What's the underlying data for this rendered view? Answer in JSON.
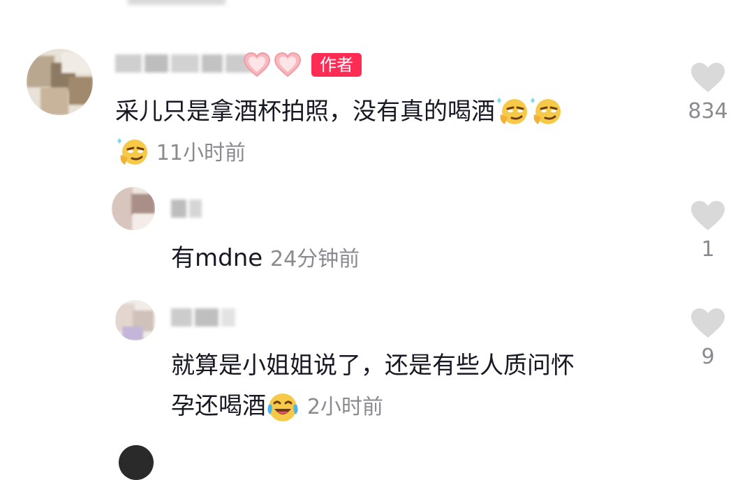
{
  "author_badge": "作者",
  "comments": [
    {
      "text": "采儿只是拿酒杯拍照，没有真的喝酒",
      "time": "11小时前",
      "likes": "834",
      "emoji": "smirk-emoji"
    },
    {
      "text": "有mdne",
      "time": "24分钟前",
      "likes": "1"
    },
    {
      "text_line1": "就算是小姐姐说了，还是有些人质问怀",
      "text_line2": "孕还喝酒",
      "time": "2小时前",
      "likes": "9",
      "emoji": "laughing-tears-emoji"
    }
  ],
  "colors": {
    "author_badge": "#fe2c55",
    "heart": "#d9d9d9",
    "secondary_text": "#8a8b91"
  }
}
